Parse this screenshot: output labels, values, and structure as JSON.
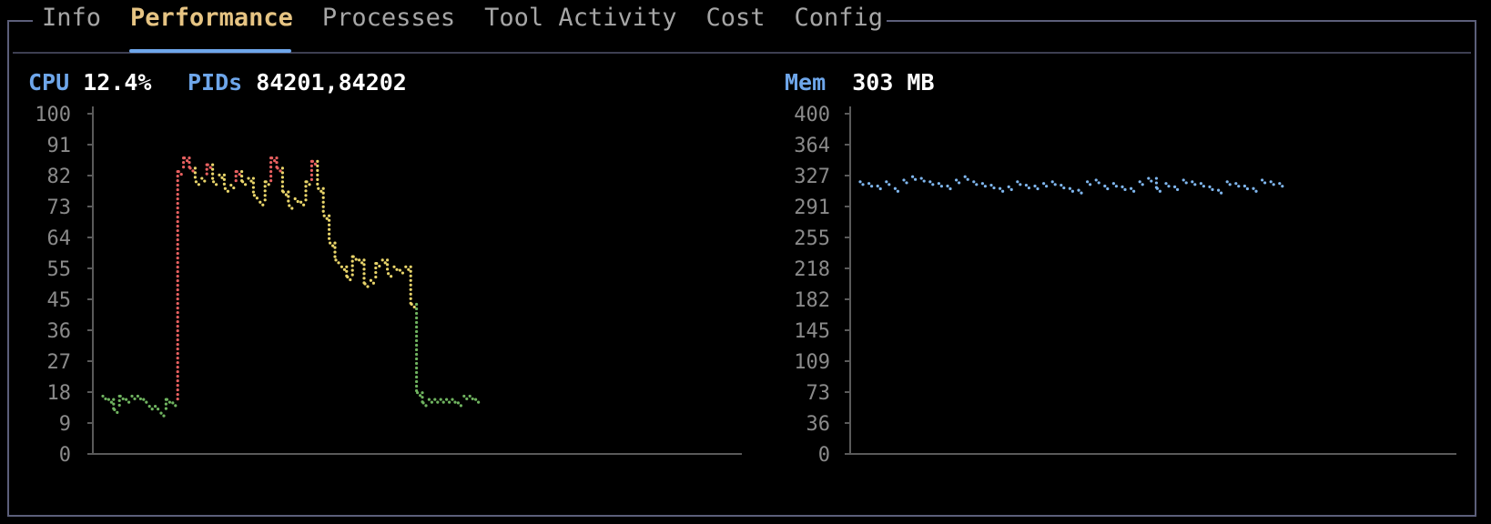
{
  "tabs": [
    {
      "label": "Info",
      "active": false
    },
    {
      "label": "Performance",
      "active": true
    },
    {
      "label": "Processes",
      "active": false
    },
    {
      "label": "Tool Activity",
      "active": false
    },
    {
      "label": "Cost",
      "active": false
    },
    {
      "label": "Config",
      "active": false
    }
  ],
  "cpu": {
    "label": "CPU",
    "value": "12.4%"
  },
  "pids": {
    "label": "PIDs",
    "value": "84201,84202"
  },
  "mem": {
    "label": "Mem",
    "value": "303 MB"
  },
  "colors": {
    "accent": "#6ea6ea",
    "tab_active": "#e6c483",
    "low": "#6fb35f",
    "mid": "#e8d46a",
    "high": "#e86060",
    "mem_series": "#7fb6ee"
  },
  "chart_data": [
    {
      "type": "scatter",
      "title": "",
      "y_ticks": [
        "100",
        "91",
        "82",
        "73",
        "64",
        "55",
        "45",
        "36",
        "27",
        "18",
        "9",
        "0"
      ],
      "ylim": [
        0,
        100
      ],
      "series": [
        {
          "values": [
            17,
            16,
            13,
            17,
            16,
            17,
            17,
            16,
            14,
            14,
            12,
            16,
            15,
            83,
            87,
            84,
            80,
            81,
            85,
            80,
            82,
            78,
            79,
            83,
            80,
            81,
            76,
            74,
            80,
            87,
            84,
            77,
            73,
            75,
            74,
            80,
            86,
            78,
            70,
            62,
            57,
            55,
            52,
            58,
            57,
            50,
            51,
            56,
            57,
            53,
            55,
            54,
            55,
            44,
            18,
            15,
            16,
            16,
            16,
            16,
            16,
            15,
            17,
            17,
            16
          ]
        }
      ]
    },
    {
      "type": "scatter",
      "title": "",
      "y_ticks": [
        "400",
        "364",
        "327",
        "291",
        "255",
        "218",
        "182",
        "145",
        "109",
        "73",
        "36",
        "0"
      ],
      "ylim": [
        0,
        400
      ],
      "series": [
        {
          "values": [
            320,
            318,
            315,
            320,
            312,
            322,
            326,
            324,
            320,
            318,
            315,
            322,
            326,
            320,
            318,
            316,
            312,
            314,
            320,
            316,
            315,
            318,
            320,
            316,
            312,
            310,
            320,
            322,
            315,
            318,
            314,
            312,
            320,
            324,
            312,
            318,
            314,
            322,
            320,
            318,
            314,
            310,
            320,
            318,
            315,
            312,
            322,
            320,
            318
          ]
        }
      ]
    }
  ]
}
